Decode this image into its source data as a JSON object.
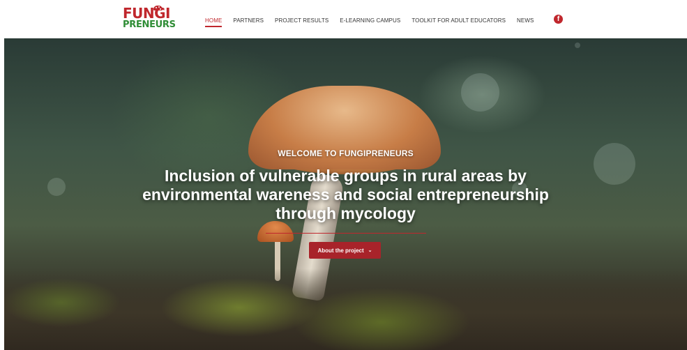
{
  "logo": {
    "line1": "FUNGI",
    "line2": "PRENEURS"
  },
  "nav": {
    "items": [
      {
        "label": "HOME",
        "active": true
      },
      {
        "label": "PARTNERS"
      },
      {
        "label": "PROJECT RESULTS"
      },
      {
        "label": "E-LEARNING CAMPUS"
      },
      {
        "label": "TOOLKIT FOR ADULT EDUCATORS"
      },
      {
        "label": "NEWS"
      }
    ],
    "social_icon": "facebook-icon"
  },
  "hero": {
    "kicker": "WELCOME TO FUNGIPRENEURS",
    "headline": "Inclusion of vulnerable groups in rural areas by environmental wareness and social entrepreneurship through mycology",
    "cta_label": "About the project",
    "cta_icon": "chevron-down-icon"
  },
  "colors": {
    "accent": "#c0272d",
    "brand_green": "#2f8d36"
  }
}
